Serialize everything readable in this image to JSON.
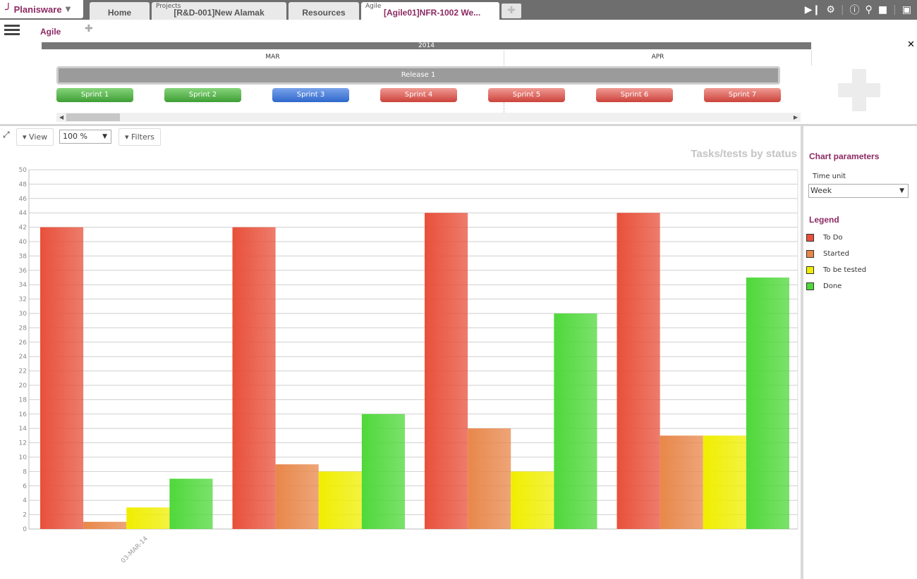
{
  "app": {
    "name": "Planisware"
  },
  "tabs": [
    {
      "sub": "",
      "label": "Home"
    },
    {
      "sub": "Projects",
      "label": "[R&D-001]New Alamak"
    },
    {
      "sub": "",
      "label": "Resources"
    },
    {
      "sub": "Agile",
      "label": "[Agile01]NFR-1002 We..."
    }
  ],
  "module": {
    "title": "Agile"
  },
  "timeline": {
    "year": "2014",
    "months": [
      "MAR",
      "APR"
    ],
    "release": "Release 1",
    "sprints": [
      {
        "label": "Sprint 1",
        "status": "green"
      },
      {
        "label": "Sprint 2",
        "status": "green"
      },
      {
        "label": "Sprint 3",
        "status": "blue"
      },
      {
        "label": "Sprint 4",
        "status": "red"
      },
      {
        "label": "Sprint 5",
        "status": "red"
      },
      {
        "label": "Sprint 6",
        "status": "red"
      },
      {
        "label": "Sprint 7",
        "status": "red"
      }
    ]
  },
  "toolbar": {
    "view": "View",
    "zoom": "100 %",
    "filters": "Filters"
  },
  "right_panel": {
    "params_heading": "Chart parameters",
    "time_unit_label": "Time unit",
    "time_unit_value": "Week",
    "legend_heading": "Legend"
  },
  "colors": {
    "accent": "#8c2a63",
    "todo": "#e8503a",
    "started": "#e8874a",
    "tested": "#f0ee00",
    "done": "#4fd83a"
  },
  "chart_data": {
    "type": "bar",
    "title": "Tasks/tests by status",
    "categories": [
      "03-MAR-14",
      "",
      "",
      ""
    ],
    "series": [
      {
        "name": "To Do",
        "values": [
          42,
          42,
          44,
          44
        ]
      },
      {
        "name": "Started",
        "values": [
          1,
          9,
          14,
          13
        ]
      },
      {
        "name": "To be tested",
        "values": [
          3,
          8,
          8,
          13
        ]
      },
      {
        "name": "Done",
        "values": [
          7,
          16,
          30,
          35
        ]
      }
    ],
    "ylim": [
      0,
      50
    ],
    "yticks": [
      0,
      2,
      4,
      6,
      8,
      10,
      12,
      14,
      16,
      18,
      20,
      22,
      24,
      26,
      28,
      30,
      32,
      34,
      36,
      38,
      40,
      42,
      44,
      46,
      48,
      50
    ],
    "grid": true,
    "legend": "right"
  }
}
